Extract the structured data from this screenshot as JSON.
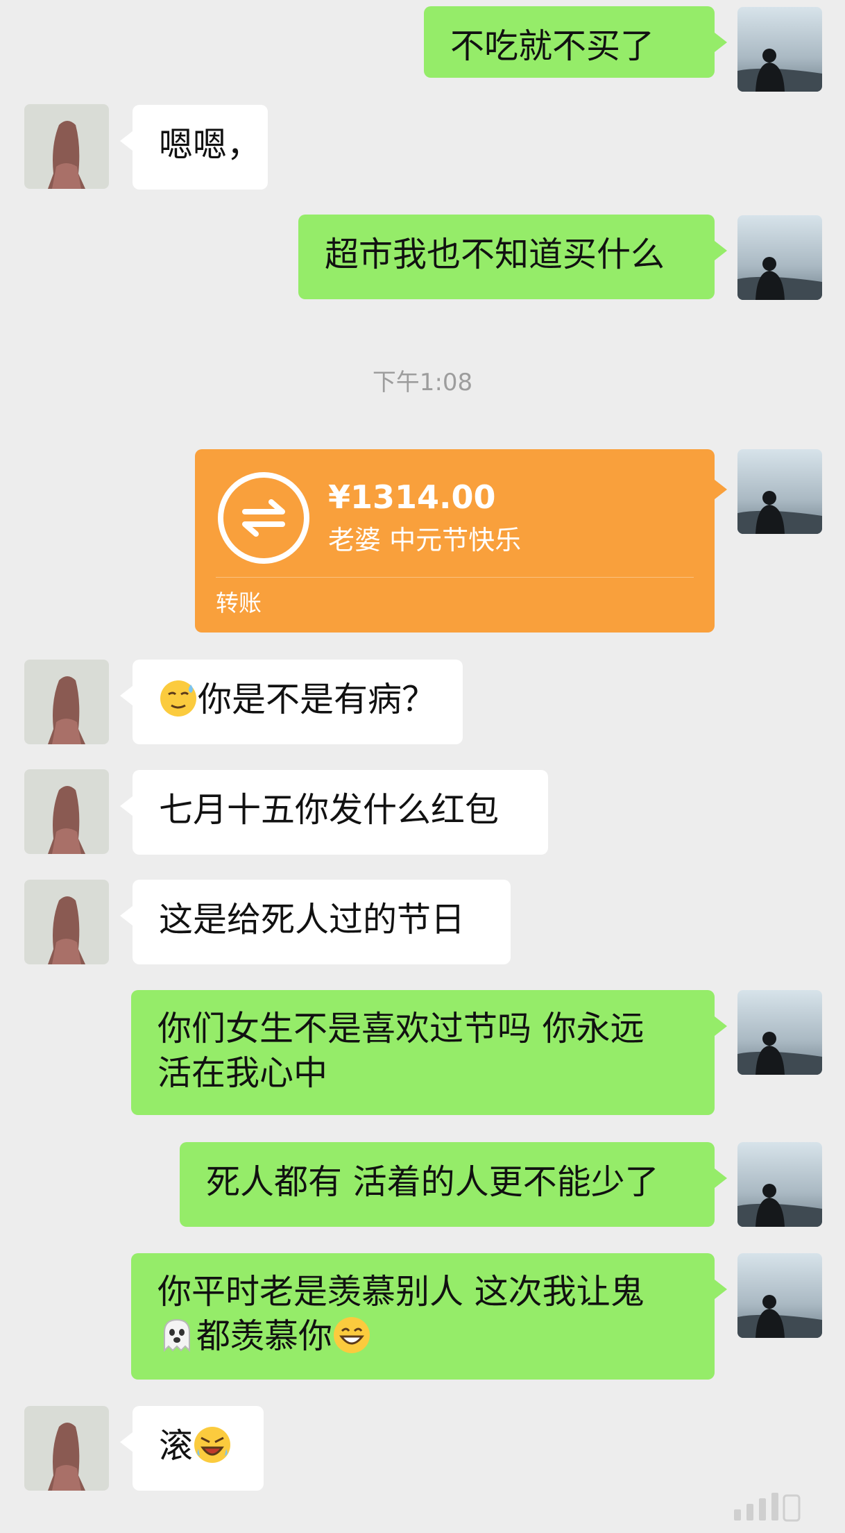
{
  "chat": {
    "timestamp": "下午1:08",
    "messages": [
      {
        "sender": "me",
        "text": "不吃就不买了"
      },
      {
        "sender": "her",
        "text": "嗯嗯，"
      },
      {
        "sender": "me",
        "text": "超市我也不知道买什么"
      },
      {
        "sender": "her",
        "emoji": "sweat-smile-emoji",
        "text": "你是不是有病？"
      },
      {
        "sender": "her",
        "text": "七月十五你发什么红包"
      },
      {
        "sender": "her",
        "text": "这是给死人过的节日"
      },
      {
        "sender": "me",
        "lines": [
          "你们女生不是喜欢过节吗 你永远",
          "活在我心中"
        ]
      },
      {
        "sender": "me",
        "text": "死人都有 活着的人更不能少了"
      },
      {
        "sender": "me",
        "lines": [
          "你平时老是羡慕别人 这次我让鬼",
          "都羡慕你"
        ],
        "emojis": [
          "ghost-emoji",
          "grin-emoji"
        ]
      },
      {
        "sender": "her",
        "text": "滚",
        "emoji": "angry-laugh-emoji"
      }
    ]
  },
  "transfer": {
    "amount": "¥1314.00",
    "note": "老婆 中元节快乐",
    "label": "转账"
  },
  "colors": {
    "background": "#ededed",
    "my_bubble": "#95ec69",
    "her_bubble": "#ffffff",
    "transfer": "#f9a03c"
  }
}
